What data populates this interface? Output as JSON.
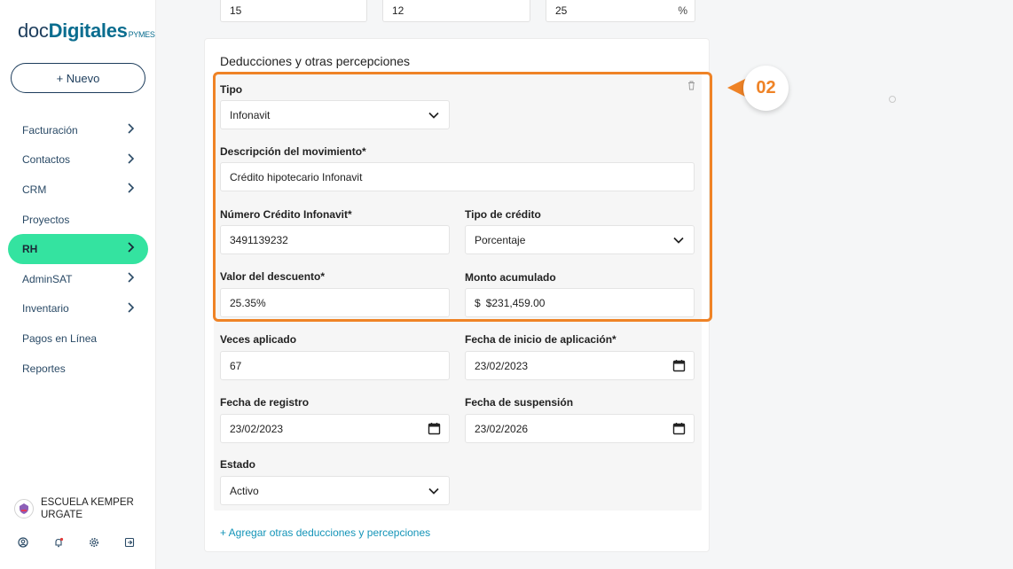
{
  "brand": {
    "part1": "doc",
    "part2": "Digitales",
    "part3": "PYMES"
  },
  "new_button": "+ Nuevo",
  "nav": [
    {
      "label": "Facturación",
      "chevron": true
    },
    {
      "label": "Contactos",
      "chevron": true
    },
    {
      "label": "CRM",
      "chevron": true
    },
    {
      "label": "Proyectos",
      "chevron": false
    },
    {
      "label": "RH",
      "chevron": true,
      "active": true
    },
    {
      "label": "AdminSAT",
      "chevron": true
    },
    {
      "label": "Inventario",
      "chevron": true
    },
    {
      "label": "Pagos en Línea",
      "chevron": false
    },
    {
      "label": "Reportes",
      "chevron": false
    }
  ],
  "org": {
    "name": "ESCUELA KEMPER URGATE"
  },
  "bottom_icons": [
    "user-icon",
    "bell-icon",
    "gear-icon",
    "logout-icon"
  ],
  "top_fields": {
    "a": "15",
    "b": "12",
    "c": "25",
    "c_unit": "%"
  },
  "section": {
    "title": "Deducciones y otras percepciones",
    "tipo_label": "Tipo",
    "tipo_value": "Infonavit",
    "descripcion_label": "Descripción del movimiento*",
    "descripcion_value": "Crédito hipotecario Infonavit",
    "numero_label": "Número Crédito Infonavit*",
    "numero_value": "3491139232",
    "tipo_credito_label": "Tipo de crédito",
    "tipo_credito_value": "Porcentaje",
    "valor_label": "Valor del descuento*",
    "valor_value": "25.35%",
    "monto_label": "Monto acumulado",
    "monto_currency": "$",
    "monto_value": "$231,459.00",
    "veces_label": "Veces aplicado",
    "veces_value": "67",
    "fecha_inicio_label": "Fecha de inicio de aplicación*",
    "fecha_inicio_value": "23/02/2023",
    "fecha_registro_label": "Fecha de registro",
    "fecha_registro_value": "23/02/2023",
    "fecha_suspension_label": "Fecha de suspensión",
    "fecha_suspension_value": "23/02/2026",
    "estado_label": "Estado",
    "estado_value": "Activo",
    "add_link": "+ Agregar otras deducciones y percepciones"
  },
  "callout": {
    "number": "02",
    "color": "#ef8326"
  },
  "colors": {
    "accent_green": "#34e3a0",
    "link": "#1494b8",
    "navy": "#1d3d5c"
  }
}
